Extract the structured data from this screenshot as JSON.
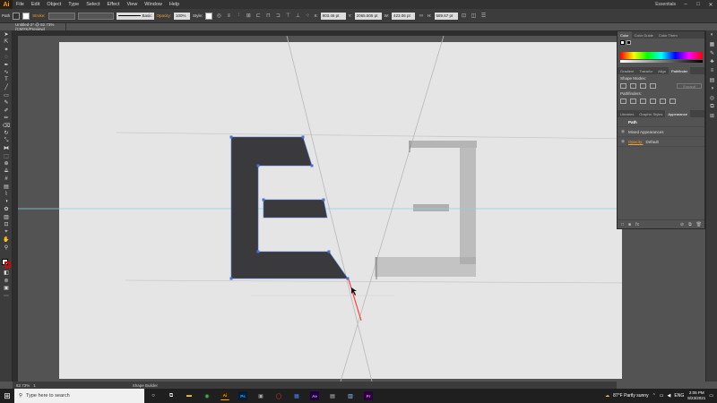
{
  "app": {
    "logo": "Ai",
    "menu": [
      "File",
      "Edit",
      "Object",
      "Type",
      "Select",
      "Effect",
      "View",
      "Window",
      "Help"
    ],
    "workspace": "Essentials",
    "window_controls": [
      "–",
      "□",
      "✕"
    ]
  },
  "control_bar": {
    "selection": "Path",
    "stroke_label": "Stroke:",
    "brush_label": "Basic",
    "opacity_label": "Opacity:",
    "opacity_value": "100%",
    "style_label": "Style:",
    "x_value": "803.46 pt",
    "y_value": "2065.505 pt",
    "w_value": "423.06 pt",
    "h_value": "589.67 pt"
  },
  "document": {
    "tab_title": "Untitled-2* @ 82.73% (CMYK/Preview)",
    "status_zoom": "82.73%",
    "status_page": "1",
    "status_tool": "Shape Builder"
  },
  "panels": {
    "top_tabs": [
      "Color",
      "Color Guide",
      "Color Them"
    ],
    "mid_tabs": [
      "Gradient",
      "Transfor",
      "Align",
      "Pathfinder"
    ],
    "shape_modes_label": "Shape Modes:",
    "expand_label": "Expand",
    "pathfinders_label": "Pathfinders:",
    "bottom_tabs": [
      "Libraries",
      "Graphic Styles",
      "Appearance"
    ],
    "appearance": {
      "path_label": "Path",
      "mixed_label": "Mixed Appearances",
      "opacity_label": "Opacity:",
      "opacity_value": "Default"
    }
  },
  "taskbar": {
    "search_placeholder": "Type here to search",
    "apps": [
      {
        "name": "Ai",
        "color": "#f7a11a",
        "bg": "#2b1f10"
      },
      {
        "name": "Ps",
        "color": "#31a8ff",
        "bg": "#001e36"
      },
      {
        "name": "Ae",
        "color": "#d291ff",
        "bg": "#1f0040"
      },
      {
        "name": "Pr",
        "color": "#ea77ff",
        "bg": "#2a003f"
      }
    ],
    "weather": "87°F  Partly sunny",
    "language": "ENG",
    "time": "2:05 PM",
    "date": "8/23/2021"
  },
  "colors": {
    "fill_shape": "#3a3a3c",
    "guide": "#7fd6e8",
    "selection": "#4a6fd6",
    "accent": "#f0a030"
  }
}
